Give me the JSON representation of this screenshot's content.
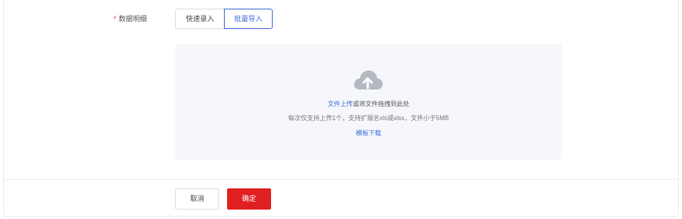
{
  "form": {
    "required_mark": "*",
    "label": "数据明细",
    "tabs": [
      {
        "label": "快速录入",
        "active": false
      },
      {
        "label": "批量导入",
        "active": true
      }
    ]
  },
  "upload": {
    "icon": "cloud-upload-icon",
    "link_text": "文件上传",
    "drag_text": "或将文件拖拽到此处",
    "hint": "每次仅支持上传1个，支持扩展名xls或xlsx，文件小于5MB",
    "template_link": "模板下载"
  },
  "footer": {
    "cancel_label": "取消",
    "confirm_label": "确定"
  },
  "colors": {
    "accent": "#3f6ad8",
    "danger": "#e02020",
    "zone_bg": "#f5f7fb"
  }
}
